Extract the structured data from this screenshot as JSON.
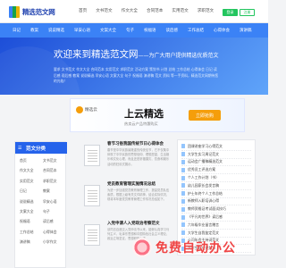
{
  "header": {
    "logo_text": "精选范文网",
    "nav": [
      "首页",
      "文书范文",
      "作文大全",
      "合同范本",
      "实用范文",
      "求职范文"
    ],
    "login": "登录",
    "register": "注册"
  },
  "catnav": [
    "日记",
    "教案",
    "说说精选",
    "早安心语",
    "文案大全",
    "句子",
    "祝福语",
    "读后感",
    "工作总结",
    "心得体会",
    "演讲稿"
  ],
  "hero": {
    "title": "欢迎来到精选范文网",
    "subtitle": "——为广大用户提供精选优质范文",
    "desc": "要求 文书范文 作文大全 合同范本 实用范文 求职范文 活动方案 策划书 计划 总结 工作总结 心得体会 日记 读后感 观后感 教案 说说精选 早安心语 文案大全 句子 祝福语 演讲稿 范文 资料 等一手资料，精选范文网期待您的光临！"
  },
  "banner": {
    "brand": "精选云",
    "heading": "上云精选",
    "tagline": "热卖云产品特惠购买",
    "button": "立即抢购"
  },
  "sidebar": {
    "title": "范文分类",
    "items": [
      "首页",
      "文书范文",
      "作文大全",
      "合同范本",
      "实用范文",
      "求职范文",
      "日记",
      "教案",
      "说说精选",
      "早安心语",
      "文案大全",
      "句子",
      "祝福语",
      "读后感",
      "工作总结",
      "心得体会",
      "演讲稿",
      "小学作文"
    ]
  },
  "articles": [
    {
      "title": "春节习俗我国传统节日心得体会",
      "snippet": "春节是中华民族最隆重的传统佳节，它不仅集中体现了中华民族的思想信仰、理想愿望、生活娱乐和文化心理，而且还是祈福攘灾、饮食和娱乐活动的狂欢式展示。"
    },
    {
      "title": "党员教育管理实施情况总结",
      "snippet": "为进一步加强党员教育管理工作，提高党员队伍素质，根据上级有关文件精神，结合实际情况，现将本年度党员教育管理工作情况总结如下。"
    },
    {
      "title": "入党申请人入党政治考察范文",
      "snippet": "该同志自递交入党申请书以来，能够认真学习马列主义、毛泽东思想和中国特色社会主义理论，政治立场坚定，思想积极上进。"
    }
  ],
  "right_list": [
    "团课讲座学习心得范文",
    "大学生实习周记范文",
    "运动会广播稿精选范文",
    "优秀员工评选方案",
    "个人工作计划（书）",
    "幼儿园家长会发言稿",
    "护士年终个人工作总结",
    "新教师入职培训心得",
    "教师资格证考试面试技巧",
    "《平凡的世界》读后感",
    "六年级毕业留言赠言",
    "大学生自我鉴定范文",
    "公司年会主持词范文",
    "大学生职业规划书"
  ],
  "watermark": "免费自动办公"
}
